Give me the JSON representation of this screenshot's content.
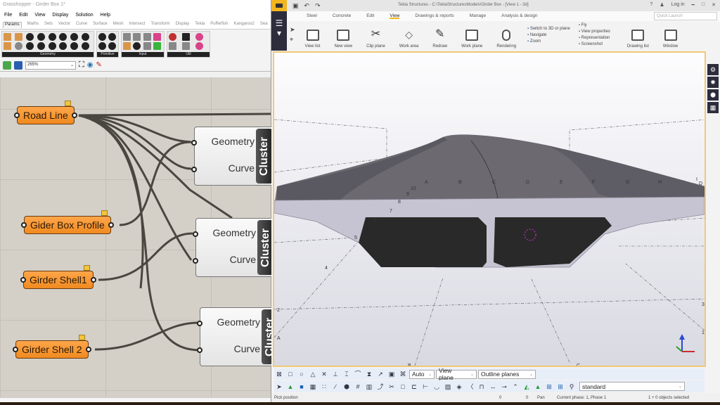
{
  "grasshopper": {
    "title": "Grasshopper - Girder Box 1*",
    "menu": [
      "File",
      "Edit",
      "View",
      "Display",
      "Solution",
      "Help"
    ],
    "tabs": [
      "Params",
      "Maths",
      "Sets",
      "Vector",
      "Curve",
      "Surface",
      "Mesh",
      "Intersect",
      "Transform",
      "Display",
      "Tekla",
      "Pufferfish",
      "Kangaroo2",
      "Sea"
    ],
    "active_tab": "Params",
    "ribbon_groups": [
      "Geometry",
      "Primitive",
      "Input",
      "Util"
    ],
    "zoom_level": "265%",
    "nodes": [
      {
        "label": "Road Line"
      },
      {
        "label": "Gider Box Profile"
      },
      {
        "label": "Girder Shell1"
      },
      {
        "label": "Girder Shell 2"
      }
    ],
    "clusters": [
      {
        "inputs": [
          "Geometry",
          "Curve"
        ],
        "tag": "Cluster"
      },
      {
        "inputs": [
          "Geometry",
          "Curve"
        ],
        "tag": "Cluster"
      },
      {
        "inputs": [
          "Geometry",
          "Curve"
        ],
        "tag": "Cluster"
      }
    ]
  },
  "tekla": {
    "title": "Tekla Structures - C:\\TeklaStructuresModels\\Girder Box - [View 1 - 3d]",
    "login": "Log in",
    "quick_launch_placeholder": "Quick Launch",
    "tabs": [
      "Steel",
      "Concrete",
      "Edit",
      "View",
      "Drawings & reports",
      "Manage",
      "Analysis & design"
    ],
    "active_tab": "View",
    "ribbon_buttons": [
      "View list",
      "New view",
      "Clip plane",
      "Work area",
      "Redraw",
      "Work plane",
      "Rendering"
    ],
    "ribbon_small_col1": [
      "Switch to 3D or plane",
      "Navigate",
      "Zoom"
    ],
    "ribbon_small_col2": [
      "Fly",
      "View properties",
      "Representation",
      "Screenshot"
    ],
    "ribbon_right": [
      "Drawing list",
      "Window"
    ],
    "grid_labels_top": [
      "A",
      "B",
      "C",
      "D",
      "E",
      "F",
      "G",
      "H",
      "I"
    ],
    "grid_labels_side": [
      "10",
      "9",
      "8",
      "7",
      "6",
      "5",
      "4"
    ],
    "grid_labels_floor": [
      "3",
      "2",
      "1",
      "A",
      "B",
      "C",
      "D"
    ],
    "snap_selects": {
      "depth": "Auto",
      "plane": "View plane",
      "outline": "Outline planes",
      "filter": "standard"
    },
    "status": {
      "prompt": "Pick position",
      "x": "0",
      "y": "0",
      "mode": "Pan",
      "phase": "Current phase: 1, Phase 1",
      "selection": "1 + 0 objects selected"
    }
  }
}
